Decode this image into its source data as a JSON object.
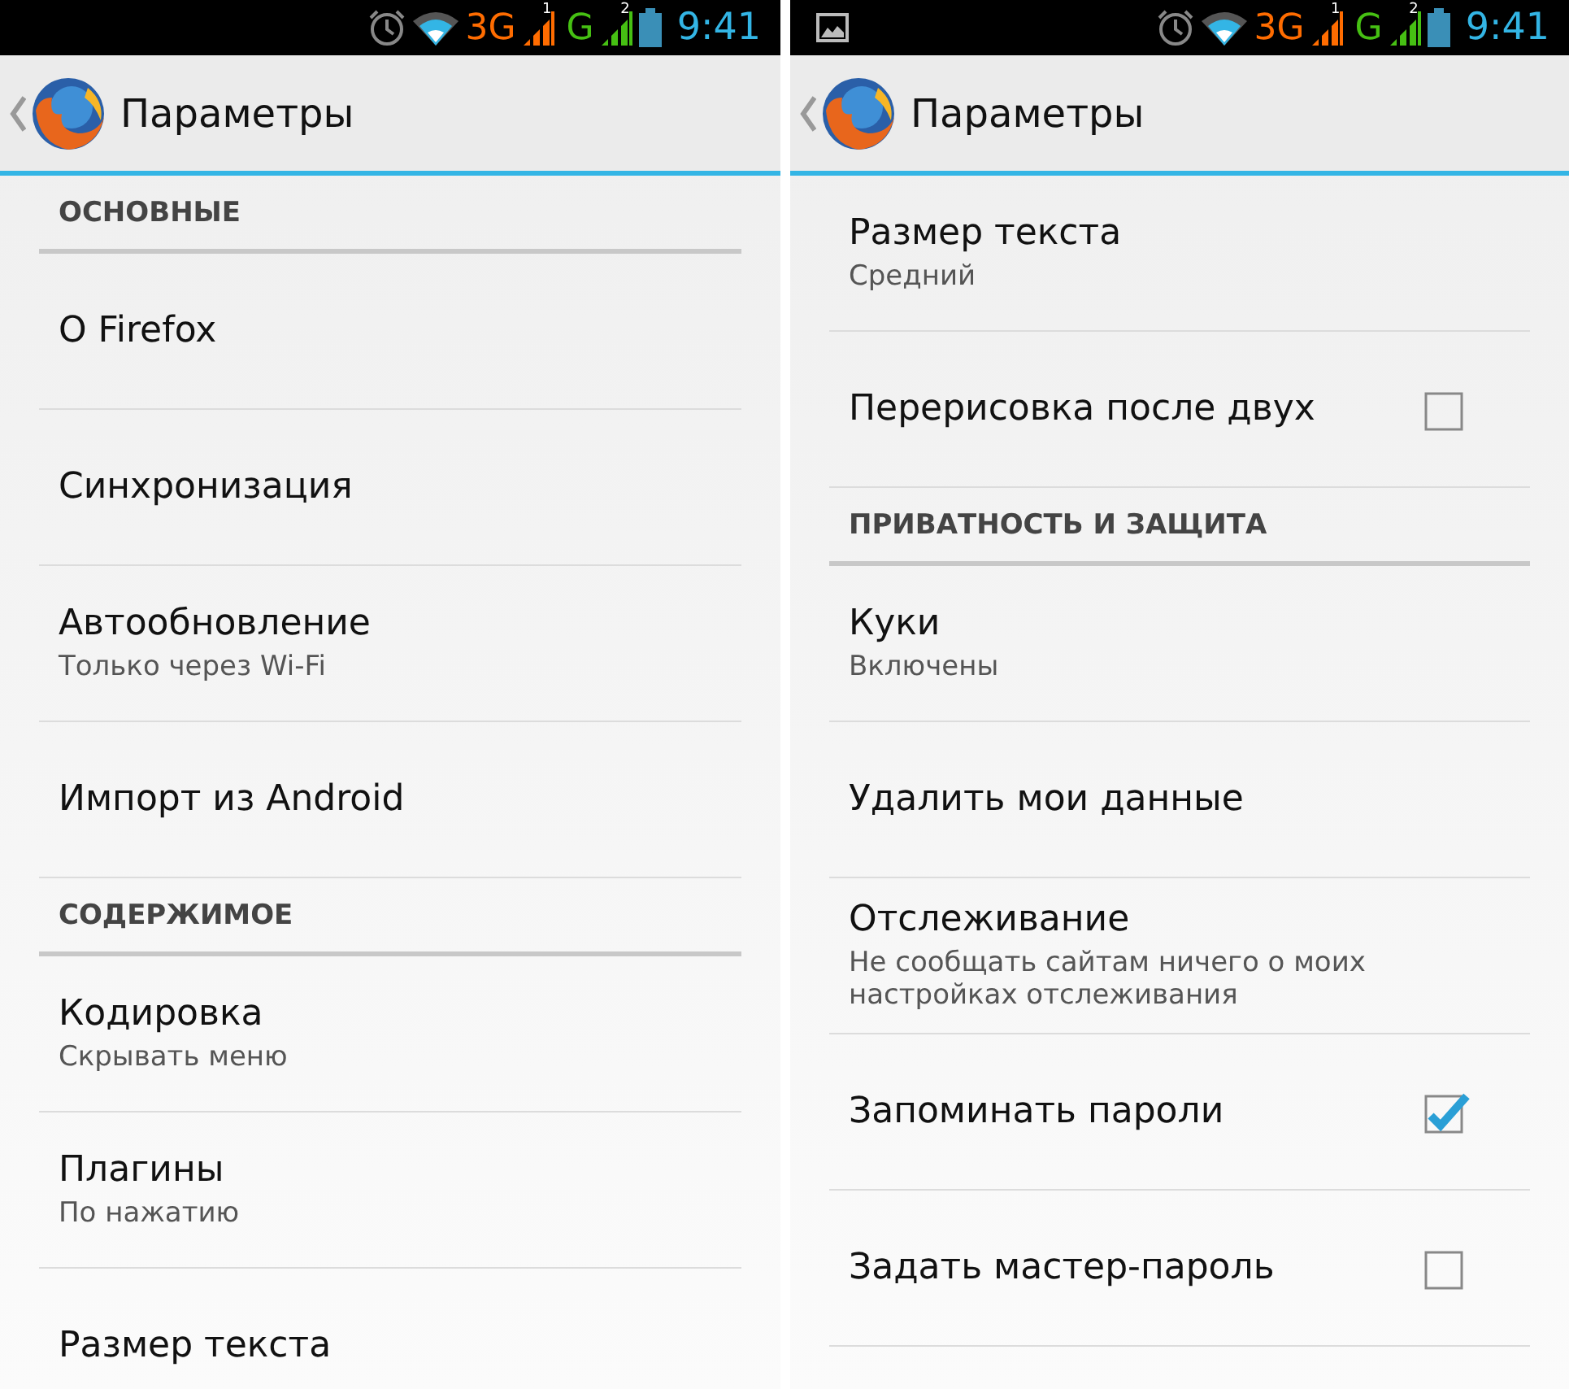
{
  "panes": [
    {
      "status_bar": {
        "notification_icon": false,
        "network_1": "3G",
        "sim_1": "1",
        "network_2": "G",
        "sim_2": "2",
        "time": "9:41"
      },
      "header": {
        "title": "Параметры"
      },
      "items": [
        {
          "kind": "section",
          "title": "ОСНОВНЫЕ"
        },
        {
          "kind": "item",
          "title": "О Firefox"
        },
        {
          "kind": "item",
          "title": "Синхронизация"
        },
        {
          "kind": "item",
          "title": "Автообновление",
          "summary": "Только через Wi-Fi"
        },
        {
          "kind": "item",
          "title": "Импорт из Android"
        },
        {
          "kind": "section",
          "title": "СОДЕРЖИМОЕ"
        },
        {
          "kind": "item",
          "title": "Кодировка",
          "summary": "Скрывать меню"
        },
        {
          "kind": "item",
          "title": "Плагины",
          "summary": "По нажатию"
        },
        {
          "kind": "item",
          "title": "Размер текста"
        }
      ]
    },
    {
      "status_bar": {
        "notification_icon": true,
        "network_1": "3G",
        "sim_1": "1",
        "network_2": "G",
        "sim_2": "2",
        "time": "9:41"
      },
      "header": {
        "title": "Параметры"
      },
      "items": [
        {
          "kind": "item",
          "title": "Размер текста",
          "summary": "Средний"
        },
        {
          "kind": "checkbox",
          "title": "Перерисовка после двух",
          "checked": false
        },
        {
          "kind": "section",
          "title": "ПРИВАТНОСТЬ И ЗАЩИТА"
        },
        {
          "kind": "item",
          "title": "Куки",
          "summary": "Включены"
        },
        {
          "kind": "item",
          "title": "Удалить мои данные"
        },
        {
          "kind": "item",
          "title": "Отслеживание",
          "summary": "Не сообщать сайтам ничего о моих настройках отслеживания"
        },
        {
          "kind": "checkbox",
          "title": "Запоминать пароли",
          "checked": true
        },
        {
          "kind": "checkbox",
          "title": "Задать мастер-пароль",
          "checked": false
        }
      ]
    }
  ]
}
